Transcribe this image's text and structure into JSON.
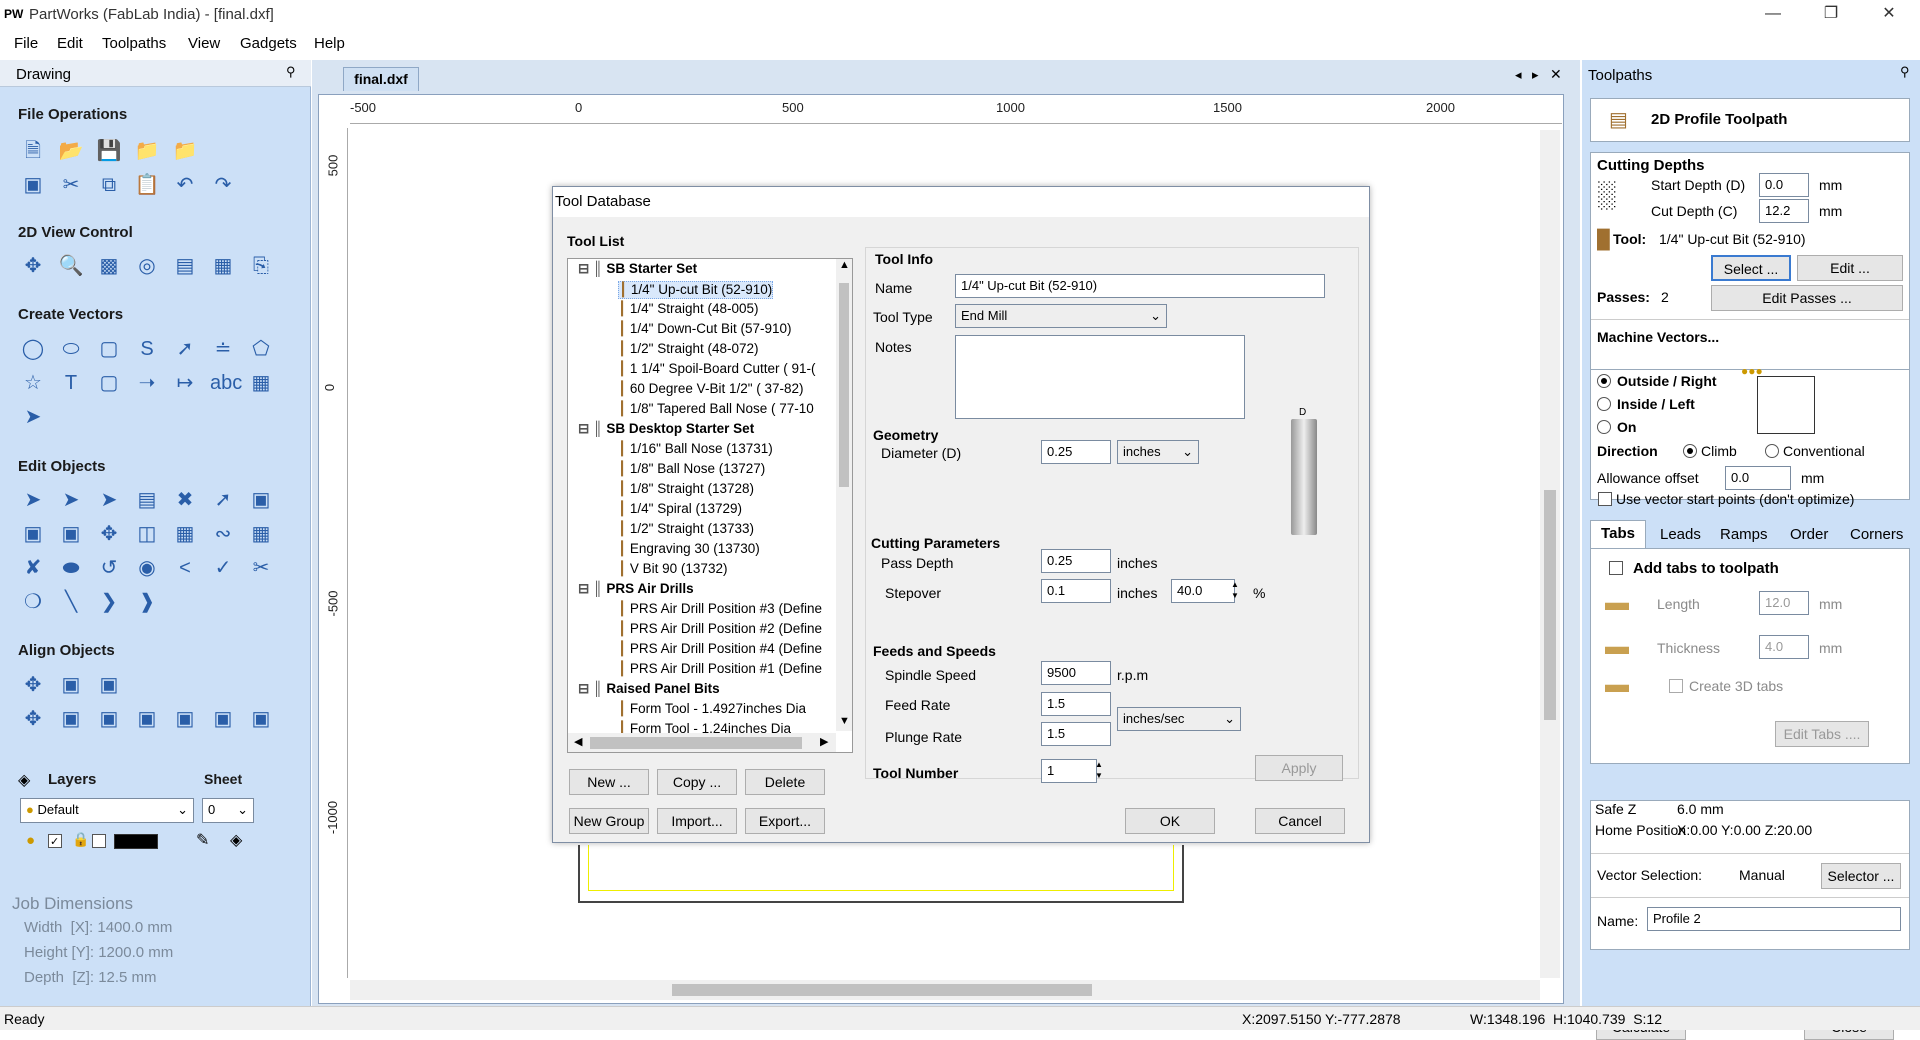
{
  "window": {
    "app_icon": "PW",
    "title": "PartWorks (FabLab India) - [final.dxf]"
  },
  "menu": [
    "File",
    "Edit",
    "Toolpaths",
    "View",
    "Gadgets",
    "Help"
  ],
  "left": {
    "panel_title": "Drawing",
    "file_ops": "File Operations",
    "view_ctrl": "2D View Control",
    "create_vec": "Create Vectors",
    "edit_obj": "Edit Objects",
    "align_obj": "Align Objects",
    "layers": "Layers",
    "sheet": "Sheet",
    "layer_value": "Default",
    "sheet_value": "0",
    "job_title": "Job Dimensions",
    "width": "Width  [X]: 1400.0 mm",
    "height": "Height [Y]: 1200.0 mm",
    "depth": "Depth  [Z]: 12.5 mm"
  },
  "doc": {
    "tab": "final.dxf",
    "hticks": [
      "-500",
      "0",
      "500",
      "1000",
      "1500",
      "2000"
    ],
    "vticks": [
      "500",
      "0",
      "-500",
      "-1000"
    ]
  },
  "dialog": {
    "title": "Tool Database",
    "tool_list": "Tool List",
    "tree": [
      {
        "t": "SB Starter Set",
        "g": true
      },
      {
        "t": "1/4\" Up-cut Bit (52-910)",
        "s": true
      },
      {
        "t": "1/4\" Straight  (48-005)"
      },
      {
        "t": "1/4\"  Down-Cut Bit (57-910)"
      },
      {
        "t": "1/2\" Straight  (48-072)"
      },
      {
        "t": "1 1/4\" Spoil-Board Cutter ( 91-("
      },
      {
        "t": "60 Degree V-Bit 1/2\"  ( 37-82)"
      },
      {
        "t": "1/8\" Tapered Ball Nose  ( 77-10"
      },
      {
        "t": "SB Desktop Starter Set",
        "g": true
      },
      {
        "t": "1/16\" Ball Nose (13731)"
      },
      {
        "t": "1/8\" Ball Nose (13727)"
      },
      {
        "t": "1/8\" Straight (13728)"
      },
      {
        "t": "1/4\" Spiral (13729)"
      },
      {
        "t": "1/2\" Straight (13733)"
      },
      {
        "t": "Engraving 30 (13730)"
      },
      {
        "t": "V Bit 90 (13732)"
      },
      {
        "t": "PRS Air Drills",
        "g": true
      },
      {
        "t": "PRS Air Drill Position #3 (Define"
      },
      {
        "t": "PRS Air Drill Position #2 (Define"
      },
      {
        "t": "PRS Air Drill Position #4 (Define"
      },
      {
        "t": "PRS Air Drill Position #1 (Define"
      },
      {
        "t": "Raised Panel Bits",
        "g": true
      },
      {
        "t": "Form Tool - 1.4927inches Dia"
      },
      {
        "t": "Form Tool - 1.24inches Dia"
      }
    ],
    "tool_info": "Tool Info",
    "name_lbl": "Name",
    "name_val": "1/4\" Up-cut Bit (52-910)",
    "type_lbl": "Tool Type",
    "type_val": "End Mill",
    "notes_lbl": "Notes",
    "geometry": "Geometry",
    "diam_lbl": "Diameter (D)",
    "diam_val": "0.25",
    "diam_unit": "inches",
    "cutting": "Cutting Parameters",
    "pass_lbl": "Pass Depth",
    "pass_val": "0.25",
    "pass_unit": "inches",
    "step_lbl": "Stepover",
    "step_val": "0.1",
    "step_unit": "inches",
    "step_pct": "40.0",
    "pct": "%",
    "feeds": "Feeds and Speeds",
    "spindle_lbl": "Spindle Speed",
    "spindle_val": "9500",
    "rpm": "r.p.m",
    "feed_lbl": "Feed Rate",
    "feed_val": "1.5",
    "plunge_lbl": "Plunge Rate",
    "plunge_val": "1.5",
    "rate_unit": "inches/sec",
    "toolnum_lbl": "Tool Number",
    "toolnum_val": "1",
    "apply": "Apply",
    "new": "New ...",
    "copy": "Copy ...",
    "delete": "Delete",
    "newgroup": "New Group",
    "import": "Import...",
    "export": "Export...",
    "ok": "OK",
    "cancel": "Cancel",
    "d_mark": "D"
  },
  "right": {
    "panel_title": "Toolpaths",
    "header": "2D Profile Toolpath",
    "cutting_depths": "Cutting Depths",
    "start_lbl": "Start Depth (D)",
    "start_val": "0.0",
    "cut_lbl": "Cut Depth (C)",
    "cut_val": "12.2",
    "mm": "mm",
    "tool_lbl": "Tool:",
    "tool_val": "1/4\" Up-cut Bit (52-910)",
    "select": "Select ...",
    "edit": "Edit ...",
    "passes_lbl": "Passes:",
    "passes_val": "2",
    "edit_passes": "Edit Passes ...",
    "mv": "Machine Vectors...",
    "outside": "Outside / Right",
    "inside": "Inside / Left",
    "on": "On",
    "direction": "Direction",
    "climb": "Climb",
    "conventional": "Conventional",
    "allow_lbl": "Allowance offset",
    "allow_val": "0.0",
    "use_vec": "Use vector start points (don't optimize)",
    "tabs": [
      "Tabs",
      "Leads",
      "Ramps",
      "Order",
      "Corners"
    ],
    "add_tabs": "Add tabs to toolpath",
    "length_lbl": "Length",
    "length_val": "12.0",
    "thick_lbl": "Thickness",
    "thick_val": "4.0",
    "create3d": "Create 3D tabs",
    "edit_tabs": "Edit Tabs ....",
    "safez_lbl": "Safe Z",
    "safez_val": "6.0 mm",
    "home_lbl": "Home Position",
    "home_val": "X:0.00 Y:0.00 Z:20.00",
    "vecsel_lbl": "Vector Selection:",
    "vecsel_val": "Manual",
    "selector": "Selector ...",
    "name_lbl": "Name:",
    "name_val": "Profile 2",
    "calculate": "Calculate",
    "close": "Close"
  },
  "status": {
    "ready": "Ready",
    "coords": "X:2097.5150 Y:-777.2878",
    "dims": "W:1348.196  H:1040.739  S:12"
  },
  "colors": {
    "panel": "#cce0f7",
    "accent": "#2a5ea8"
  }
}
